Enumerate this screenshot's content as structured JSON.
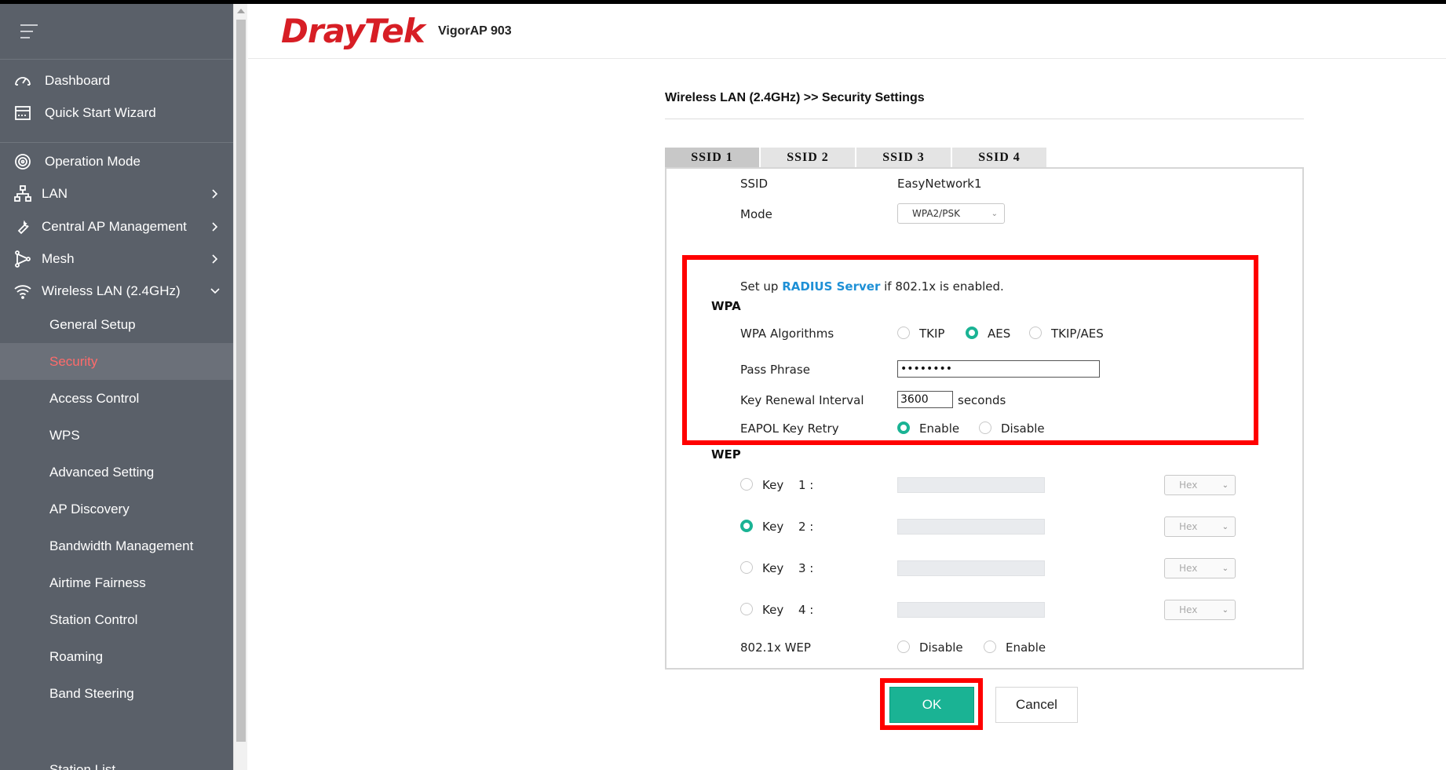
{
  "brand": {
    "logo": "DrayTek",
    "model": "VigorAP 903"
  },
  "sidebar": {
    "items": [
      {
        "label": "Dashboard",
        "icon": "gauge-icon"
      },
      {
        "label": "Quick Start Wizard",
        "icon": "wizard-icon"
      },
      {
        "label": "Operation Mode",
        "icon": "operation-icon"
      },
      {
        "label": "LAN",
        "icon": "network-icon"
      },
      {
        "label": "Central AP Management",
        "icon": "wrench-icon"
      },
      {
        "label": "Mesh",
        "icon": "mesh-icon"
      },
      {
        "label": "Wireless LAN (2.4GHz)",
        "icon": "wifi-icon"
      }
    ],
    "subitems": [
      "General Setup",
      "Security",
      "Access Control",
      "WPS",
      "Advanced Setting",
      "AP Discovery",
      "Bandwidth Management",
      "Airtime Fairness",
      "Station Control",
      "Roaming",
      "Band Steering",
      "Station List"
    ],
    "active_sub": "Security",
    "active_color": "#ff6b6b"
  },
  "page": {
    "breadcrumb": "Wireless LAN (2.4GHz) >> Security Settings",
    "tabs": [
      "SSID 1",
      "SSID 2",
      "SSID 3",
      "SSID 4"
    ],
    "active_tab": "SSID 1"
  },
  "form": {
    "ssid_label": "SSID",
    "ssid_value": "EasyNetwork1",
    "mode_label": "Mode",
    "mode_value": "WPA2/PSK",
    "radius_prefix": "Set up",
    "radius_link": "RADIUS Server",
    "radius_suffix": "if 802.1x is enabled.",
    "wpa_heading": "WPA",
    "wpa_alg_label": "WPA Algorithms",
    "wpa_alg_options": [
      "TKIP",
      "AES",
      "TKIP/AES"
    ],
    "wpa_alg_selected": "AES",
    "pass_label": "Pass Phrase",
    "pass_value": "••••••••",
    "key_renewal_label": "Key Renewal Interval",
    "key_renewal_value": "3600",
    "key_renewal_unit": "seconds",
    "eapol_label": "EAPOL Key Retry",
    "eapol_options": [
      "Enable",
      "Disable"
    ],
    "eapol_selected": "Enable",
    "wep_heading": "WEP",
    "wep_keys": [
      {
        "label": "Key",
        "num": "1 :",
        "format": "Hex",
        "selected": false
      },
      {
        "label": "Key",
        "num": "2 :",
        "format": "Hex",
        "selected": true
      },
      {
        "label": "Key",
        "num": "3 :",
        "format": "Hex",
        "selected": false
      },
      {
        "label": "Key",
        "num": "4 :",
        "format": "Hex",
        "selected": false
      }
    ],
    "wep8021x_label": "802.1x WEP",
    "wep8021x_options": [
      "Disable",
      "Enable"
    ],
    "wep8021x_selected": "none"
  },
  "actions": {
    "ok": "OK",
    "cancel": "Cancel"
  },
  "colors": {
    "accent": "#1ab394",
    "brand": "#d71e25",
    "highlight": "#ff0000",
    "sidebar": "#5a6069"
  }
}
